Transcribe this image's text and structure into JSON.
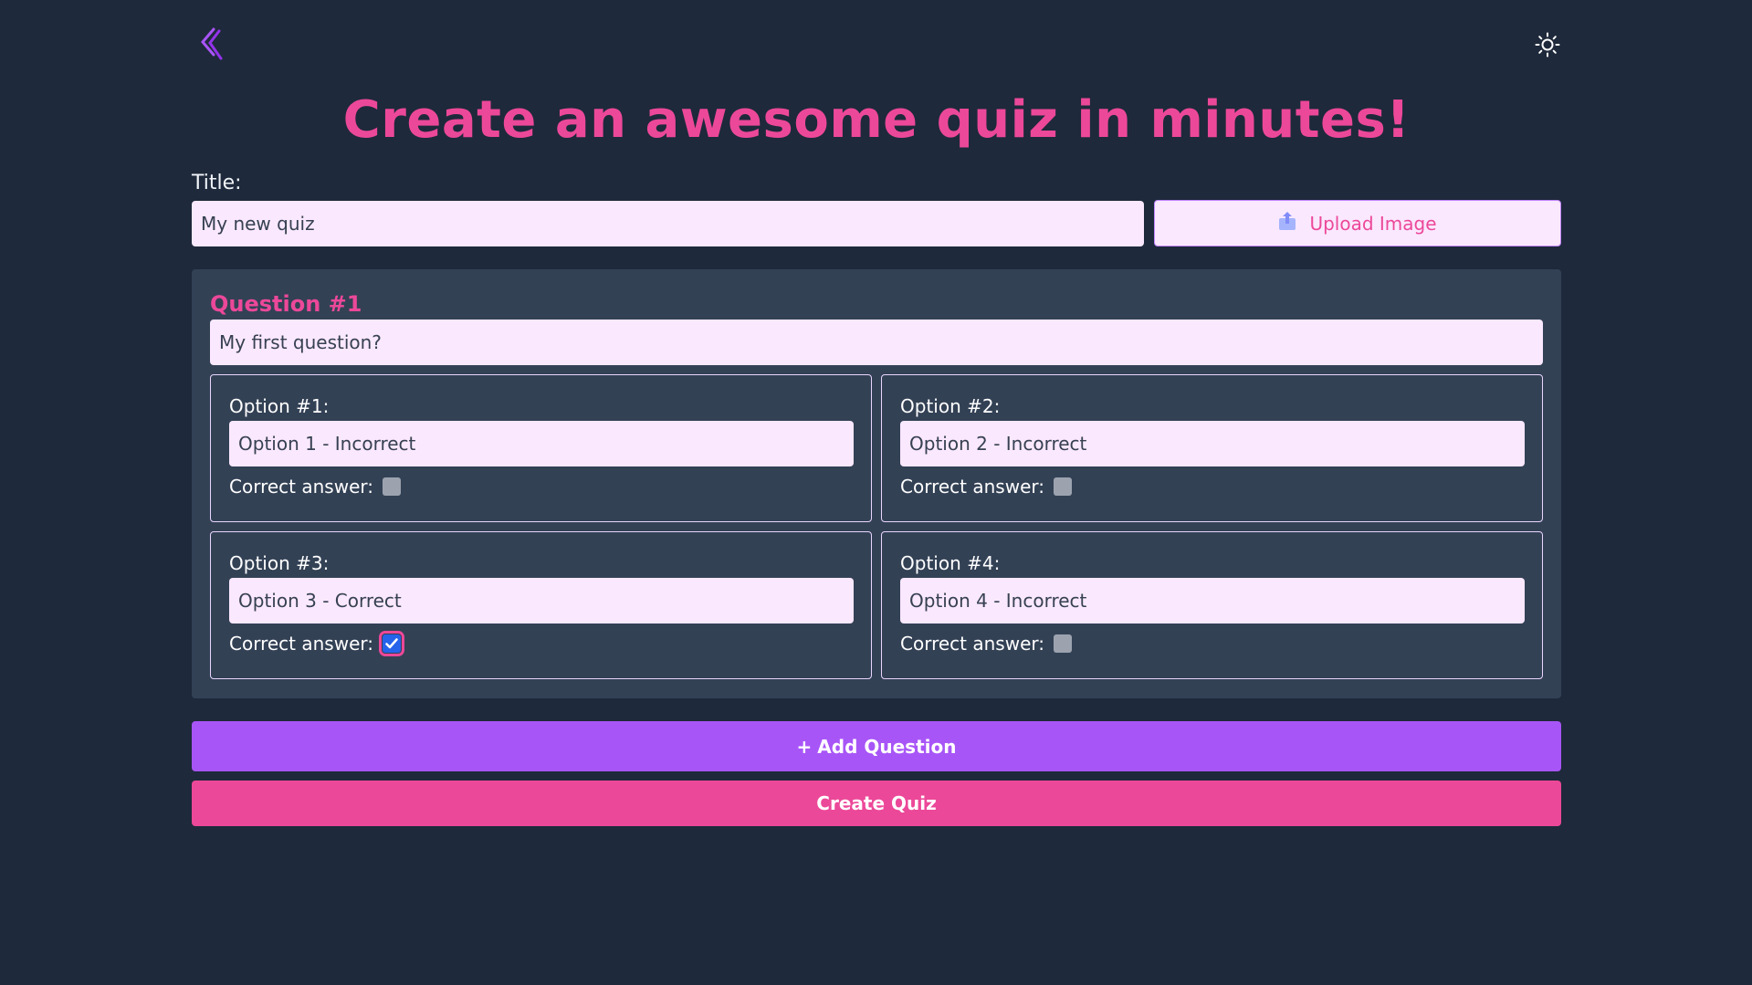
{
  "app": {
    "logo_icon": "double-chevron-left-logo-icon",
    "theme_toggle_icon": "sun-icon",
    "brand_color": "#ec4899",
    "accent_color": "#a855f7",
    "background_color": "#1e293b"
  },
  "hero": {
    "heading": "Create an awesome quiz in minutes!"
  },
  "quiz": {
    "title_label": "Title:",
    "title_value": "My new quiz",
    "upload_label": "Upload Image",
    "upload_icon": "upload-icon"
  },
  "question": {
    "heading": "Question #1",
    "value": "My first question?",
    "options": [
      {
        "label": "Option #1:",
        "value": "Option 1 - Incorrect",
        "correct_label": "Correct answer:",
        "correct": false
      },
      {
        "label": "Option #2:",
        "value": "Option 2 - Incorrect",
        "correct_label": "Correct answer:",
        "correct": false
      },
      {
        "label": "Option #3:",
        "value": "Option 3 - Correct",
        "correct_label": "Correct answer:",
        "correct": true
      },
      {
        "label": "Option #4:",
        "value": "Option 4 - Incorrect",
        "correct_label": "Correct answer:",
        "correct": false
      }
    ]
  },
  "actions": {
    "add_question_icon": "+",
    "add_question_label": "Add Question",
    "create_quiz_label": "Create Quiz"
  }
}
